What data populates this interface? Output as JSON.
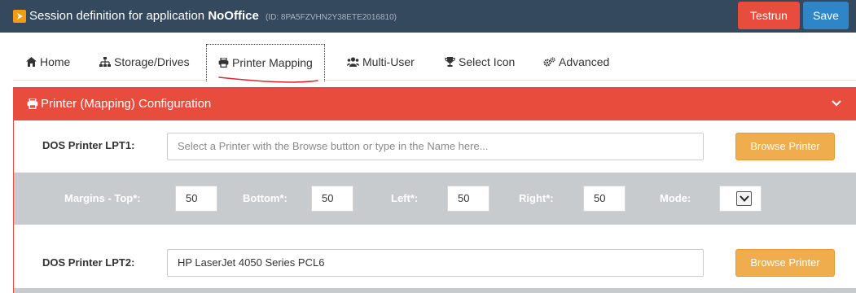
{
  "header": {
    "title_prefix": "Session definition for application",
    "app_name": "NoOffice",
    "session_id": "(ID: 8PA5FZVHN2Y38ETE2016810)",
    "testrun_label": "Testrun",
    "save_label": "Save"
  },
  "tabs": [
    {
      "label": "Home",
      "icon": "home-icon"
    },
    {
      "label": "Storage/Drives",
      "icon": "sitemap-icon"
    },
    {
      "label": "Printer Mapping",
      "icon": "printer-icon",
      "active": true
    },
    {
      "label": "Multi-User",
      "icon": "users-icon"
    },
    {
      "label": "Select Icon",
      "icon": "trophy-icon"
    },
    {
      "label": "Advanced",
      "icon": "gears-icon"
    }
  ],
  "panel": {
    "title": "Printer (Mapping) Configuration",
    "accent_color": "#e74c3c"
  },
  "lpt1": {
    "label": "DOS Printer LPT1:",
    "value": "",
    "placeholder": "Select a Printer with the Browse button or type in the Name here...",
    "browse_label": "Browse Printer"
  },
  "margins": {
    "top_label": "Margins - Top*:",
    "top_value": "50",
    "bottom_label": "Bottom*:",
    "bottom_value": "50",
    "left_label": "Left*:",
    "left_value": "50",
    "right_label": "Right*:",
    "right_value": "50",
    "mode_label": "Mode:"
  },
  "lpt2": {
    "label": "DOS Printer LPT2:",
    "value": "HP LaserJet 4050 Series PCL6",
    "browse_label": "Browse Printer"
  }
}
